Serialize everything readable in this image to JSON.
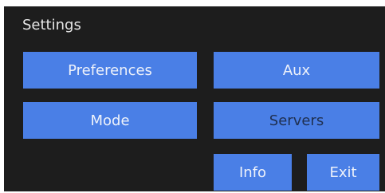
{
  "window": {
    "title": "Settings"
  },
  "buttons": {
    "preferences": "Preferences",
    "aux": "Aux",
    "mode": "Mode",
    "servers": "Servers",
    "info": "Info",
    "exit": "Exit"
  },
  "colors": {
    "background": "#1d1d1d",
    "button": "#4a7fe6",
    "button_text": "#eef2fa",
    "disabled_text": "#1f2f4f",
    "title_text": "#e6e6e6"
  }
}
